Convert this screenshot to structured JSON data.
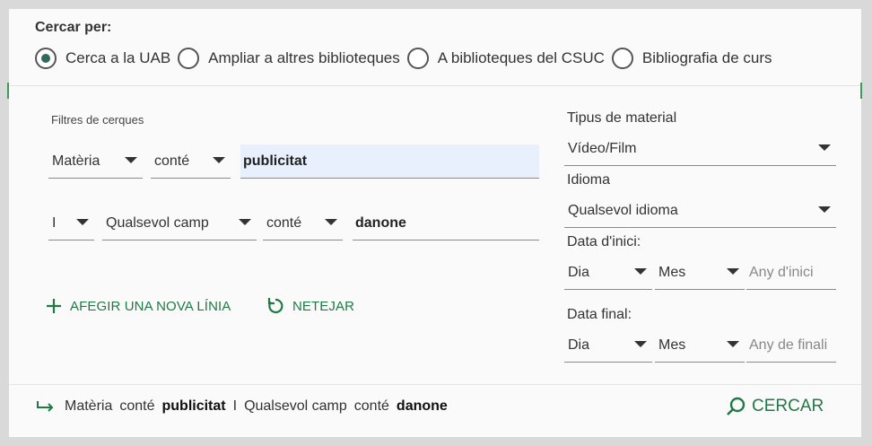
{
  "scope": {
    "title": "Cercar per:",
    "options": [
      {
        "label": "Cerca a la UAB",
        "selected": true
      },
      {
        "label": "Ampliar a altres biblioteques",
        "selected": false
      },
      {
        "label": "A biblioteques del CSUC",
        "selected": false
      },
      {
        "label": "Bibliografia de curs",
        "selected": false
      }
    ]
  },
  "filters": {
    "title": "Filtres de cerques",
    "row1": {
      "field": "Matèria",
      "operator": "conté",
      "value": "publicitat"
    },
    "row2": {
      "boolean": "I",
      "field": "Qualsevol camp",
      "operator": "conté",
      "value": "danone"
    },
    "add_line": "AFEGIR UNA NOVA LÍNIA",
    "clear": "NETEJAR"
  },
  "right": {
    "material_label": "Tipus de material",
    "material_value": "Vídeo/Film",
    "language_label": "Idioma",
    "language_value": "Qualsevol idioma",
    "start_label": "Data d'inici:",
    "start_day": "Dia",
    "start_month": "Mes",
    "start_year_placeholder": "Any d'inici",
    "end_label": "Data final:",
    "end_day": "Dia",
    "end_month": "Mes",
    "end_year_placeholder": "Any de finali"
  },
  "summary": {
    "t1": "Matèria",
    "t2": "conté",
    "t3": "publicitat",
    "t4": "I",
    "t5": "Qualsevol camp",
    "t6": "conté",
    "t7": "danone"
  },
  "search_button": "CERCAR",
  "colors": {
    "accent": "#1f7a46",
    "radio_selected": "#2f6b5a",
    "highlight": "#e9f0fd"
  }
}
